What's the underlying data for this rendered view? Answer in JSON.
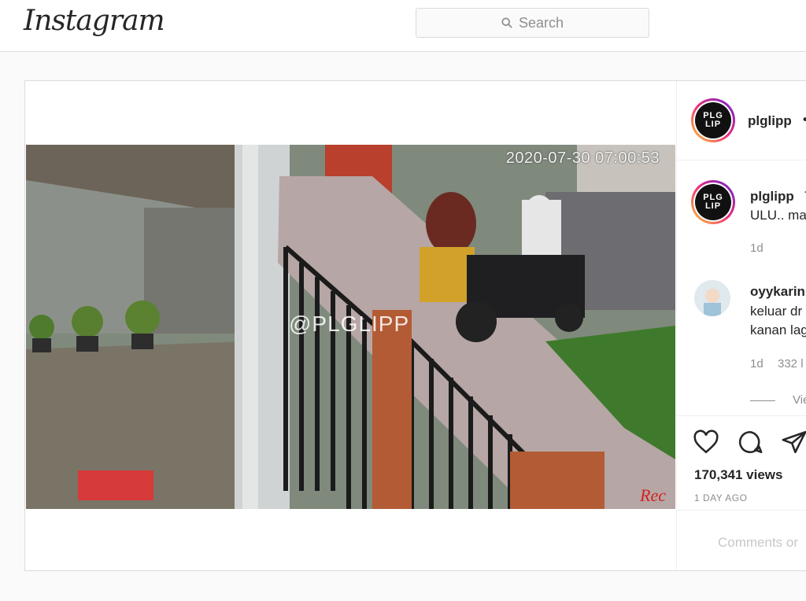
{
  "nav": {
    "logo": "Instagram",
    "search_placeholder": "Search"
  },
  "video": {
    "timestamp": "2020-07-30 07:00:53",
    "watermark": "@PLGLIPP",
    "rec_label": "Rec"
  },
  "post": {
    "author": "plglipp",
    "header_dot": "•",
    "avatar_text": "PLG LIP",
    "caption_start": "T",
    "caption_line2": "ULU.. ma",
    "caption_time": "1d",
    "comment": {
      "author": "oyykarin",
      "line1": "keluar dr",
      "line2": "kanan lag",
      "time": "1d",
      "likes": "332 l"
    },
    "view_replies": "Vie",
    "views": "170,341 views",
    "posted": "1 DAY AGO",
    "add_comment_placeholder": "Comments or"
  }
}
